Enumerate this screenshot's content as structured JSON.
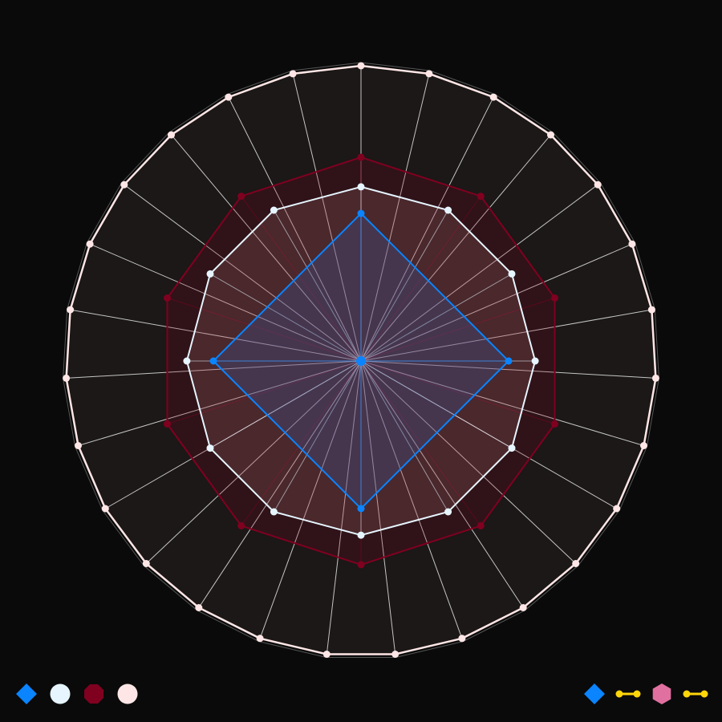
{
  "colors": {
    "background": "#0a0a0a",
    "grid_fill": "#272220",
    "grid_line": "#ffffff"
  },
  "chart_data": {
    "type": "radar",
    "title": "",
    "grid": true,
    "rlim": [
      0,
      1
    ],
    "series": [
      {
        "axes": 27,
        "value": 1.0,
        "color": "#ffe6e6",
        "fill": "#272220",
        "fill_opacity": 0.6,
        "marker": "circle"
      },
      {
        "axes": 10,
        "value": 0.69,
        "color": "#800020",
        "fill": "#800020",
        "fill_opacity": 0.2,
        "marker": "circle"
      },
      {
        "axes": 12,
        "value": 0.59,
        "color": "#e6f5ff",
        "fill": "#e6a0a0",
        "fill_opacity": 0.15,
        "marker": "circle"
      },
      {
        "axes": 4,
        "value": 0.5,
        "color": "#0a84ff",
        "fill": "#3a5aa0",
        "fill_opacity": 0.3,
        "marker": "circle"
      }
    ],
    "legend": {
      "left": [
        {
          "icon": "diamond-icon",
          "color": "#0a84ff"
        },
        {
          "icon": "circle-icon",
          "color": "#e6f5ff"
        },
        {
          "icon": "octagon-icon",
          "color": "#800020"
        },
        {
          "icon": "circle-icon",
          "color": "#ffe6e6"
        }
      ],
      "right": [
        {
          "icon": "diamond-icon",
          "color": "#0a84ff"
        },
        {
          "icon": "line-dot-icon",
          "color": "#ffd60a"
        },
        {
          "icon": "hexagon-icon",
          "color": "#e070a0"
        },
        {
          "icon": "line-dot-icon",
          "color": "#ffd60a"
        }
      ]
    }
  }
}
